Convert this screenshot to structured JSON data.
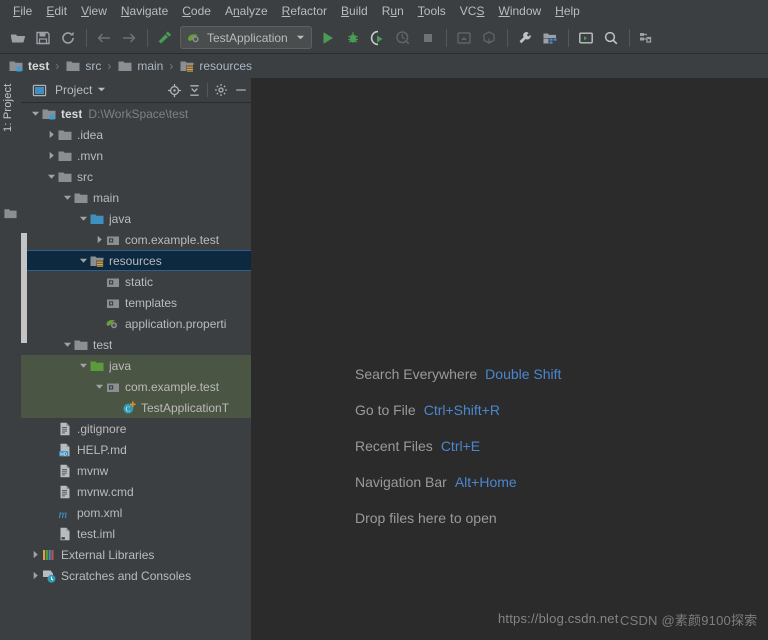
{
  "menubar": {
    "items": [
      {
        "pre": "",
        "mn": "F",
        "post": "ile"
      },
      {
        "pre": "",
        "mn": "E",
        "post": "dit"
      },
      {
        "pre": "",
        "mn": "V",
        "post": "iew"
      },
      {
        "pre": "",
        "mn": "N",
        "post": "avigate"
      },
      {
        "pre": "",
        "mn": "C",
        "post": "ode"
      },
      {
        "pre": "A",
        "mn": "n",
        "post": "alyze"
      },
      {
        "pre": "",
        "mn": "R",
        "post": "efactor"
      },
      {
        "pre": "",
        "mn": "B",
        "post": "uild"
      },
      {
        "pre": "R",
        "mn": "u",
        "post": "n"
      },
      {
        "pre": "",
        "mn": "T",
        "post": "ools"
      },
      {
        "pre": "VC",
        "mn": "S",
        "post": ""
      },
      {
        "pre": "",
        "mn": "W",
        "post": "indow"
      },
      {
        "pre": "",
        "mn": "H",
        "post": "elp"
      }
    ]
  },
  "toolbar": {
    "open_title": "Open",
    "save_title": "Save All",
    "sync_title": "Synchronize",
    "back_title": "Back",
    "forward_title": "Forward",
    "build_title": "Build Project",
    "run_config": "TestApplication",
    "run_title": "Run",
    "debug_title": "Debug",
    "coverage_title": "Run with Coverage",
    "profiler_title": "Profiler",
    "stop_title": "Stop",
    "update_title": "Update Project",
    "commit_title": "Commit",
    "settings_title": "Settings",
    "structure_title": "Project Structure",
    "terminal_title": "Terminal",
    "search_title": "Search Everywhere",
    "layout_title": "Save Layout"
  },
  "breadcrumb": {
    "items": [
      {
        "label": "test",
        "icon": "module-icon"
      },
      {
        "label": "src",
        "icon": "folder-icon"
      },
      {
        "label": "main",
        "icon": "folder-icon"
      },
      {
        "label": "resources",
        "icon": "resources-folder-icon"
      }
    ],
    "separator": "›"
  },
  "rail": {
    "label": "1: Project"
  },
  "panel": {
    "title": "Project",
    "dropdown_glyph": "▼",
    "locate_title": "Select Opened File",
    "collapse_title": "Collapse All",
    "settings_title": "Settings",
    "hide_title": "Hide"
  },
  "tree": {
    "nodes": [
      {
        "indent": 0,
        "arrow": "down",
        "icon": "module-icon",
        "label": "test",
        "bold": true,
        "path": "D:\\WorkSpace\\test",
        "state": "normal"
      },
      {
        "indent": 1,
        "arrow": "right",
        "icon": "folder-icon",
        "label": ".idea",
        "bold": false,
        "path": "",
        "state": "normal"
      },
      {
        "indent": 1,
        "arrow": "right",
        "icon": "folder-icon",
        "label": ".mvn",
        "bold": false,
        "path": "",
        "state": "normal"
      },
      {
        "indent": 1,
        "arrow": "down",
        "icon": "folder-icon",
        "label": "src",
        "bold": false,
        "path": "",
        "state": "normal"
      },
      {
        "indent": 2,
        "arrow": "down",
        "icon": "folder-icon",
        "label": "main",
        "bold": false,
        "path": "",
        "state": "normal"
      },
      {
        "indent": 3,
        "arrow": "down",
        "icon": "source-root-icon",
        "label": "java",
        "bold": false,
        "path": "",
        "state": "normal"
      },
      {
        "indent": 4,
        "arrow": "right",
        "icon": "package-icon",
        "label": "com.example.test",
        "bold": false,
        "path": "",
        "state": "normal"
      },
      {
        "indent": 3,
        "arrow": "down",
        "icon": "resources-folder-icon",
        "label": "resources",
        "bold": false,
        "path": "",
        "state": "selected"
      },
      {
        "indent": 4,
        "arrow": "none",
        "icon": "package-icon",
        "label": "static",
        "bold": false,
        "path": "",
        "state": "normal"
      },
      {
        "indent": 4,
        "arrow": "none",
        "icon": "package-icon",
        "label": "templates",
        "bold": false,
        "path": "",
        "state": "normal"
      },
      {
        "indent": 4,
        "arrow": "none",
        "icon": "spring-icon",
        "label": "application.properti",
        "bold": false,
        "path": "",
        "state": "normal"
      },
      {
        "indent": 2,
        "arrow": "down",
        "icon": "folder-icon",
        "label": "test",
        "bold": false,
        "path": "",
        "state": "normal"
      },
      {
        "indent": 3,
        "arrow": "down",
        "icon": "test-root-icon",
        "label": "java",
        "bold": false,
        "path": "",
        "state": "testroot"
      },
      {
        "indent": 4,
        "arrow": "down",
        "icon": "package-icon",
        "label": "com.example.test",
        "bold": false,
        "path": "",
        "state": "testroot"
      },
      {
        "indent": 5,
        "arrow": "none",
        "icon": "test-class-icon",
        "label": "TestApplicationT",
        "bold": false,
        "path": "",
        "state": "testroot"
      },
      {
        "indent": 1,
        "arrow": "none",
        "icon": "file-icon",
        "label": ".gitignore",
        "bold": false,
        "path": "",
        "state": "normal"
      },
      {
        "indent": 1,
        "arrow": "none",
        "icon": "markdown-icon",
        "label": "HELP.md",
        "bold": false,
        "path": "",
        "state": "normal"
      },
      {
        "indent": 1,
        "arrow": "none",
        "icon": "file-icon",
        "label": "mvnw",
        "bold": false,
        "path": "",
        "state": "normal"
      },
      {
        "indent": 1,
        "arrow": "none",
        "icon": "file-icon",
        "label": "mvnw.cmd",
        "bold": false,
        "path": "",
        "state": "normal"
      },
      {
        "indent": 1,
        "arrow": "none",
        "icon": "maven-icon",
        "label": "pom.xml",
        "bold": false,
        "path": "",
        "state": "normal"
      },
      {
        "indent": 1,
        "arrow": "none",
        "icon": "iml-icon",
        "label": "test.iml",
        "bold": false,
        "path": "",
        "state": "normal"
      },
      {
        "indent": 0,
        "arrow": "right",
        "icon": "libraries-icon",
        "label": "External Libraries",
        "bold": false,
        "path": "",
        "state": "normal"
      },
      {
        "indent": 0,
        "arrow": "right",
        "icon": "scratches-icon",
        "label": "Scratches and Consoles",
        "bold": false,
        "path": "",
        "state": "normal"
      }
    ]
  },
  "editor": {
    "hints": [
      {
        "label": "Search Everywhere",
        "key": "Double Shift"
      },
      {
        "label": "Go to File",
        "key": "Ctrl+Shift+R"
      },
      {
        "label": "Recent Files",
        "key": "Ctrl+E"
      },
      {
        "label": "Navigation Bar",
        "key": "Alt+Home"
      },
      {
        "label": "Drop files here to open",
        "key": ""
      }
    ],
    "watermark_url": "https://blog.csdn.net",
    "watermark_user": "CSDN @素颜9100探索"
  },
  "colors": {
    "accent_blue": "#4b87cf",
    "selection": "#0d293f",
    "test_root": "#4b5543",
    "editor_bg": "#2b2b2b",
    "chrome_bg": "#3c3f41"
  }
}
